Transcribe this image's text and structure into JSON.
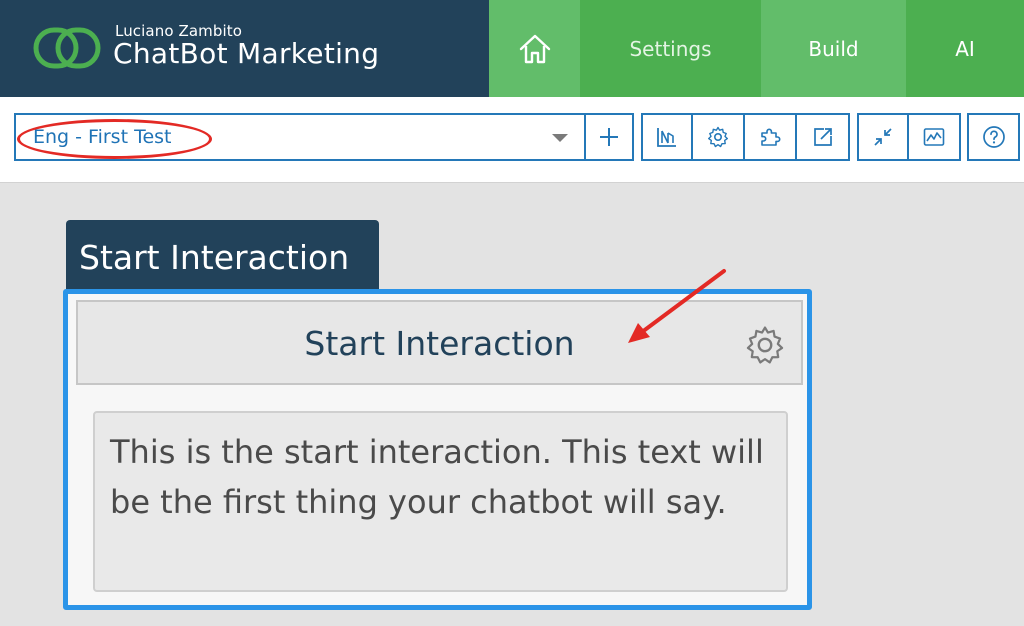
{
  "brand": {
    "subtitle": "Luciano Zambito",
    "title": "ChatBot Marketing",
    "logo_color": "#4caf50"
  },
  "nav": {
    "home_icon": "home-icon",
    "settings_label": "Settings",
    "build_label": "Build",
    "ai_label": "AI"
  },
  "toolbar": {
    "selected_bot": "Eng - First Test",
    "highlight_color": "#e32a25",
    "icons": [
      "plus-icon",
      "flow-chart-icon",
      "gear-icon",
      "puzzle-icon",
      "export-icon",
      "collapse-icon",
      "analytics-icon",
      "help-icon"
    ]
  },
  "canvas": {
    "node_tag": "Start Interaction",
    "node_title": "Start Interaction",
    "node_text": "This is the start interaction. This text will be the first thing your chatbot will say.",
    "accent_color": "#2b94e8"
  },
  "colors": {
    "header_dark": "#22425a",
    "nav_green": "#4caf50",
    "nav_green_light": "#62bd6a",
    "toolbar_blue": "#2478b8"
  }
}
